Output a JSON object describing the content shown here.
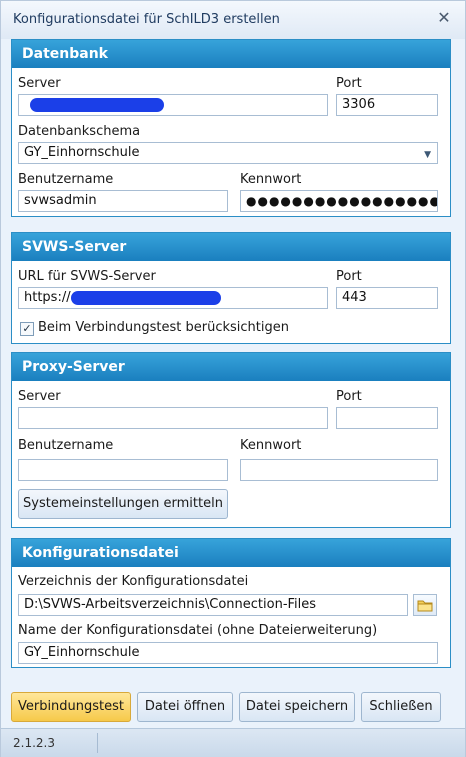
{
  "window": {
    "title": "Konfigurationsdatei für SchILD3 erstellen",
    "close_glyph": "✕"
  },
  "datenbank": {
    "header": "Datenbank",
    "server_label": "Server",
    "server_value": "",
    "port_label": "Port",
    "port_value": "3306",
    "schema_label": "Datenbankschema",
    "schema_value": "GY_Einhornschule",
    "user_label": "Benutzername",
    "user_value": "svwsadmin",
    "password_label": "Kennwort",
    "password_value": "●●●●●●●●●●●●●●●●●●●●"
  },
  "svws": {
    "header": "SVWS-Server",
    "url_label": "URL für SVWS-Server",
    "url_prefix": "https://",
    "port_label": "Port",
    "port_value": "443",
    "check_label": "Beim Verbindungstest berücksichtigen",
    "checked": true
  },
  "proxy": {
    "header": "Proxy-Server",
    "server_label": "Server",
    "server_value": "",
    "port_label": "Port",
    "port_value": "",
    "user_label": "Benutzername",
    "user_value": "",
    "password_label": "Kennwort",
    "password_value": "",
    "detect_button": "Systemeinstellungen ermitteln"
  },
  "config": {
    "header": "Konfigurationsdatei",
    "dir_label": "Verzeichnis der Konfigurationsdatei",
    "dir_value": "D:\\SVWS-Arbeitsverzeichnis\\Connection-Files",
    "name_label": "Name der Konfigurationsdatei (ohne Dateierweiterung)",
    "name_value": "GY_Einhornschule"
  },
  "buttons": {
    "test": "Verbindungstest",
    "open": "Datei öffnen",
    "save": "Datei speichern",
    "close": "Schließen"
  },
  "status": {
    "version": "2.1.2.3"
  },
  "colors": {
    "group_header": "#1a7fbf",
    "active_button": "#f6c94a",
    "redaction": "#1b3fe8"
  }
}
